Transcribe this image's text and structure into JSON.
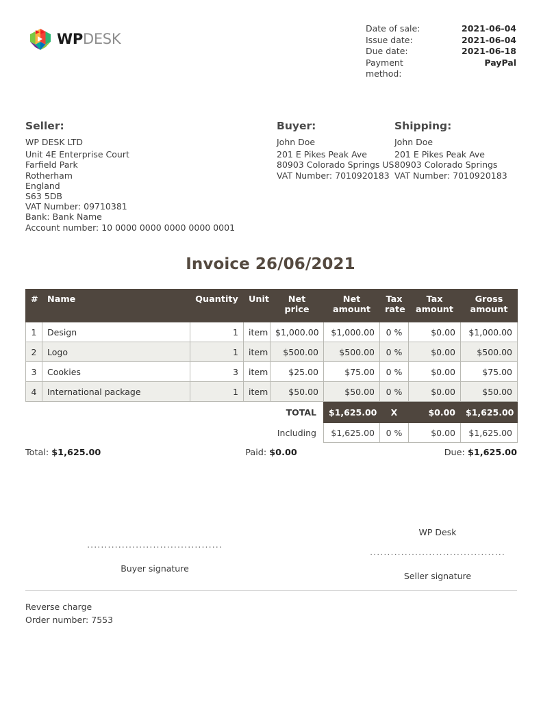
{
  "brand": {
    "logo_wp": "WP",
    "logo_desk": "DESK",
    "logo_icon": "wpdesk-cube-logo"
  },
  "meta": {
    "rows": [
      {
        "label": "Date of sale:",
        "value": "2021-06-04"
      },
      {
        "label": "Issue date:",
        "value": "2021-06-04"
      },
      {
        "label": "Due date:",
        "value": "2021-06-18"
      },
      {
        "label": "Payment method:",
        "value": "PayPal"
      }
    ]
  },
  "seller": {
    "heading": "Seller:",
    "name": "WP DESK LTD",
    "lines": [
      "Unit 4E Enterprise Court",
      "Farfield Park",
      "Rotherham",
      "England",
      "S63 5DB",
      "VAT Number: 09710381",
      "Bank: Bank Name",
      "Account number: 10 0000 0000 0000 0000 0001"
    ]
  },
  "buyer": {
    "heading": "Buyer:",
    "name": "John Doe",
    "lines": [
      "201 E Pikes Peak Ave",
      "80903 Colorado Springs US",
      "VAT Number: 7010920183"
    ]
  },
  "shipping": {
    "heading": "Shipping:",
    "name": "John Doe",
    "lines": [
      "201 E Pikes Peak Ave",
      "80903 Colorado Springs",
      "VAT Number: 7010920183"
    ]
  },
  "title": "Invoice 26/06/2021",
  "table": {
    "headers": {
      "num": "#",
      "name": "Name",
      "quantity": "Quantity",
      "unit": "Unit",
      "net_price": "Net price",
      "net_amount": "Net amount",
      "tax_rate": "Tax rate",
      "tax_amount": "Tax amount",
      "gross_amount": "Gross amount"
    },
    "rows": [
      {
        "num": "1",
        "name": "Design",
        "quantity": "1",
        "unit": "item",
        "net_price": "$1,000.00",
        "net_amount": "$1,000.00",
        "tax_rate": "0 %",
        "tax_amount": "$0.00",
        "gross_amount": "$1,000.00"
      },
      {
        "num": "2",
        "name": "Logo",
        "quantity": "1",
        "unit": "item",
        "net_price": "$500.00",
        "net_amount": "$500.00",
        "tax_rate": "0 %",
        "tax_amount": "$0.00",
        "gross_amount": "$500.00"
      },
      {
        "num": "3",
        "name": "Cookies",
        "quantity": "3",
        "unit": "item",
        "net_price": "$25.00",
        "net_amount": "$75.00",
        "tax_rate": "0 %",
        "tax_amount": "$0.00",
        "gross_amount": "$75.00"
      },
      {
        "num": "4",
        "name": "International package",
        "quantity": "1",
        "unit": "item",
        "net_price": "$50.00",
        "net_amount": "$50.00",
        "tax_rate": "0 %",
        "tax_amount": "$0.00",
        "gross_amount": "$50.00"
      }
    ],
    "total_row": {
      "label": "TOTAL",
      "net_amount": "$1,625.00",
      "tax_rate": "X",
      "tax_amount": "$0.00",
      "gross_amount": "$1,625.00"
    },
    "including_row": {
      "label": "Including",
      "net_amount": "$1,625.00",
      "tax_rate": "0 %",
      "tax_amount": "$0.00",
      "gross_amount": "$1,625.00"
    }
  },
  "summary": {
    "total_label": "Total:",
    "total_value": "$1,625.00",
    "paid_label": "Paid:",
    "paid_value": "$0.00",
    "due_label": "Due:",
    "due_value": "$1,625.00"
  },
  "signatures": {
    "buyer_dots": ".......................................",
    "buyer_caption": "Buyer signature",
    "seller_name": "WP Desk",
    "seller_dots": ".......................................",
    "seller_caption": "Seller signature"
  },
  "footer": {
    "reverse_charge": "Reverse charge",
    "order_number": "Order number: 7553"
  },
  "colors": {
    "header_bg": "#4f463e",
    "alt_row_bg": "#eeeeea",
    "title": "#54493f",
    "border": "#b9b9b3"
  }
}
